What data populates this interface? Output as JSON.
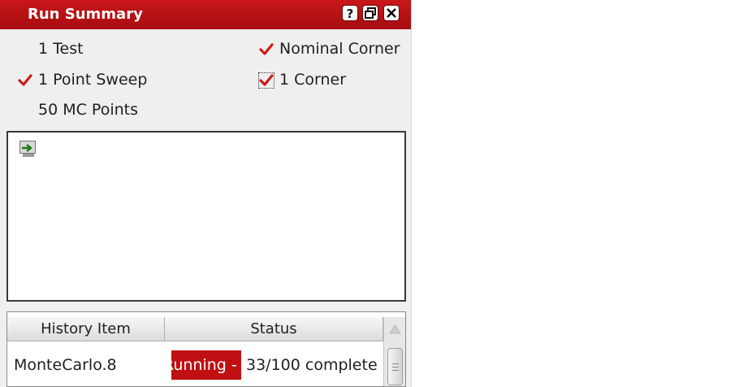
{
  "window": {
    "title": "Run Summary",
    "buttons": [
      "help-icon",
      "float-icon",
      "close-icon"
    ],
    "accent_color": "#b81216"
  },
  "summary": {
    "tests": "1 Test",
    "sweep": "1 Point Sweep",
    "mc_points": "50 MC Points",
    "nominal_corner": "Nominal Corner",
    "corners": "1 Corner",
    "sweep_checked": true,
    "nominal_corner_checked": true,
    "corners_checked": true
  },
  "history_table": {
    "columns": [
      "History Item",
      "Status"
    ],
    "rows": [
      {
        "item": "MonteCarlo.8",
        "status_badge": "Running -",
        "status_text": "33/100 complete",
        "status_color": "#c01014"
      }
    ]
  }
}
